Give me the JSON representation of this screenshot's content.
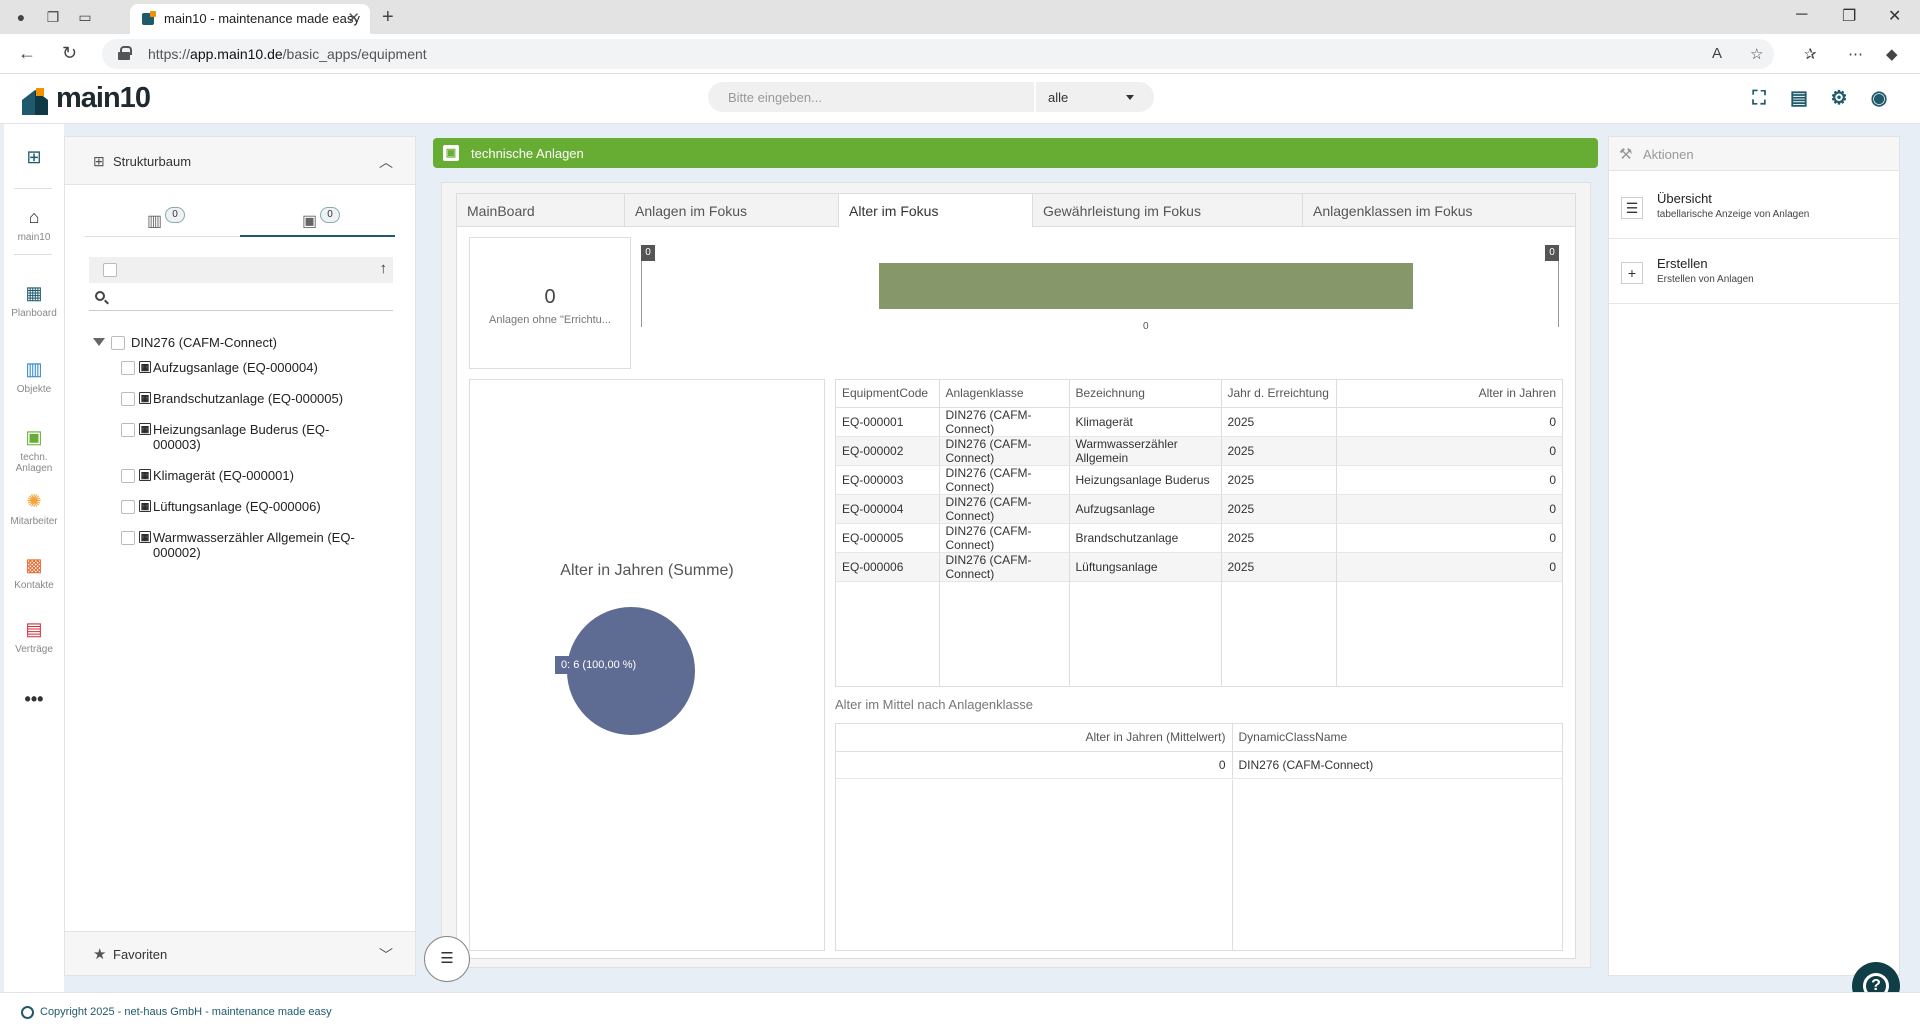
{
  "browser": {
    "tab_title": "main10 - maintenance made easy",
    "url_prefix": "https://",
    "url_domain": "app.main10.de",
    "url_path": "/basic_apps/equipment"
  },
  "header": {
    "logo_text": "main10",
    "search_placeholder": "Bitte eingeben...",
    "scope_value": "alle"
  },
  "rail": {
    "items": [
      {
        "label": "main10"
      },
      {
        "label": "Planboard"
      },
      {
        "label": "Objekte"
      },
      {
        "label": "techn. Anlagen"
      },
      {
        "label": "Mitarbeiter"
      },
      {
        "label": "Kontakte"
      },
      {
        "label": "Verträge"
      }
    ]
  },
  "tree": {
    "title": "Strukturbaum",
    "tab_counts": [
      "0",
      "0"
    ],
    "root": "DIN276 (CAFM-Connect)",
    "nodes": [
      {
        "label": "Aufzugsanlage (EQ-000004)"
      },
      {
        "label": "Brandschutzanlage (EQ-000005)"
      },
      {
        "label_line1": "Heizungsanlage Buderus (EQ-",
        "label_line2": "000003)"
      },
      {
        "label": "Klimagerät (EQ-000001)"
      },
      {
        "label": "Lüftungsanlage (EQ-000006)"
      },
      {
        "label_line1": "Warmwasserzähler Allgemein (EQ-",
        "label_line2": "000002)"
      }
    ],
    "favorites": "Favoriten"
  },
  "main": {
    "section_title": "technische Anlagen",
    "tabs": [
      {
        "label": "MainBoard"
      },
      {
        "label": "Anlagen im Fokus"
      },
      {
        "label": "Alter im Fokus"
      },
      {
        "label": "Gewährleistung im Fokus"
      },
      {
        "label": "Anlagenklassen im Fokus"
      }
    ],
    "kpi": {
      "value": "0",
      "label": "Anlagen ohne \"Errichtu..."
    },
    "bar_chart": {
      "tick_left": "0",
      "tick_right": "0",
      "x_label": "0"
    },
    "pie": {
      "title": "Alter in Jahren (Summe)",
      "slice_label": "0: 6 (100,00 %)"
    },
    "grid": {
      "headers": [
        "EquipmentCode",
        "Anlagenklasse",
        "Bezeichnung",
        "Jahr d. Erreichtung",
        "Alter in Jahren"
      ],
      "rows": [
        [
          "EQ-000001",
          "DIN276 (CAFM-Connect)",
          "Klimagerät",
          "2025",
          "0"
        ],
        [
          "EQ-000002",
          "DIN276 (CAFM-Connect)",
          "Warmwasserzähler Allgemein",
          "2025",
          "0"
        ],
        [
          "EQ-000003",
          "DIN276 (CAFM-Connect)",
          "Heizungsanlage Buderus",
          "2025",
          "0"
        ],
        [
          "EQ-000004",
          "DIN276 (CAFM-Connect)",
          "Aufzugsanlage",
          "2025",
          "0"
        ],
        [
          "EQ-000005",
          "DIN276 (CAFM-Connect)",
          "Brandschutzanlage",
          "2025",
          "0"
        ],
        [
          "EQ-000006",
          "DIN276 (CAFM-Connect)",
          "Lüftungsanlage",
          "2025",
          "0"
        ]
      ]
    },
    "avg_title": "Alter im Mittel nach Anlagenklasse",
    "avg_grid": {
      "headers": [
        "Alter in Jahren (Mittelwert)",
        "DynamicClassName"
      ],
      "rows": [
        [
          "0",
          "DIN276 (CAFM-Connect)"
        ]
      ]
    }
  },
  "chart_data": [
    {
      "type": "bar",
      "categories": [
        "0"
      ],
      "values": [
        6
      ],
      "title": "",
      "xlabel": "",
      "ylabel": ""
    },
    {
      "type": "pie",
      "title": "Alter in Jahren (Summe)",
      "categories": [
        "0"
      ],
      "values": [
        6
      ],
      "percent": [
        100.0
      ],
      "colors": [
        "#5e6b93"
      ]
    }
  ],
  "actions": {
    "title": "Aktionen",
    "items": [
      {
        "title": "Übersicht",
        "desc": "tabellarische Anzeige von Anlagen"
      },
      {
        "title": "Erstellen",
        "desc": "Erstellen von Anlagen"
      }
    ]
  },
  "footer": {
    "text": "Copyright 2025 - net-haus GmbH - maintenance made easy"
  },
  "colors": {
    "brand_dark": "#1e5a6b",
    "accent_green": "#67ad33",
    "bar": "#86976a",
    "pie": "#5e6b93"
  }
}
